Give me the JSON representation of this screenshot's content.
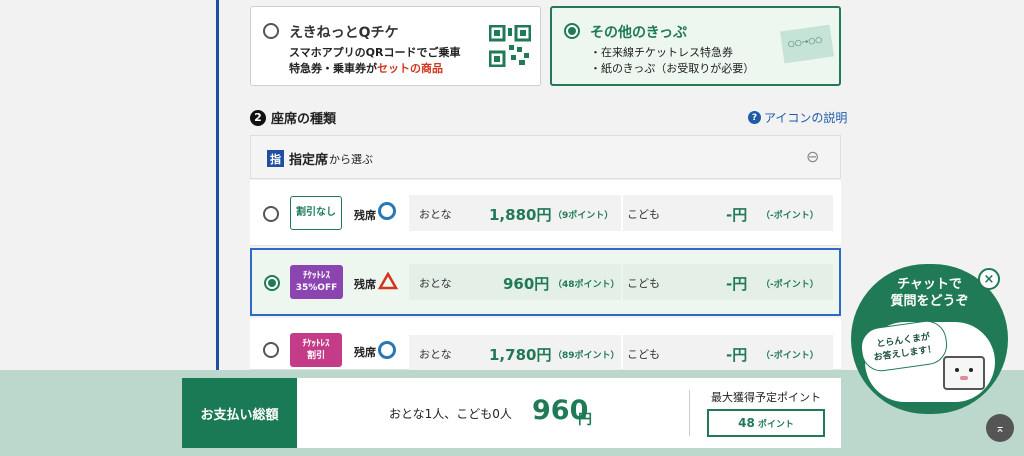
{
  "tickets": {
    "ekinet": {
      "title": "えきねっとQチケ",
      "line1": "スマホアプリのQRコードでご乗車",
      "line2_prefix": "特急券・乗車券が",
      "line2_highlight": "セットの商品"
    },
    "other": {
      "title": "その他のきっぷ",
      "bullet1": "・在来線チケットレス特急券",
      "bullet2": "・紙のきっぷ（お受取りが必要）",
      "ticket_img_text": "○○→○○"
    }
  },
  "seat_section": {
    "number": "2",
    "title": "座席の種類",
    "help_text": "アイコンの説明",
    "reserved_badge": "指",
    "reserved_title": "指定席",
    "reserved_suffix": "から選ぶ",
    "collapse_icon": "⊖"
  },
  "rows": [
    {
      "tag": "割引なし",
      "tag_line2": "",
      "remain_label": "残席",
      "remain_symbol": "○",
      "adult_label": "おとな",
      "adult_price": "1,880円",
      "adult_points": "（9ポイント）",
      "child_label": "こども",
      "child_price": "-円",
      "child_points": "（-ポイント）",
      "selected": false
    },
    {
      "tag": "ﾁｹｯﾄﾚｽ",
      "tag_line2": "35%OFF",
      "remain_label": "残席",
      "remain_symbol": "△",
      "adult_label": "おとな",
      "adult_price": "960円",
      "adult_points": "（48ポイント）",
      "child_label": "こども",
      "child_price": "-円",
      "child_points": "（-ポイント）",
      "selected": true
    },
    {
      "tag": "ﾁｹｯﾄﾚｽ",
      "tag_line2": "割引",
      "remain_label": "残席",
      "remain_symbol": "○",
      "adult_label": "おとな",
      "adult_price": "1,780円",
      "adult_points": "（89ポイント）",
      "child_label": "こども",
      "child_price": "-円",
      "child_points": "（-ポイント）",
      "selected": false
    }
  ],
  "footer": {
    "pay_label": "お支払い総額",
    "passengers": "おとな1人、こども0人",
    "total_amount": "960",
    "total_unit": "円",
    "points_title": "最大獲得予定ポイント",
    "points_value": "48",
    "points_unit": "ポイント"
  },
  "chat": {
    "line1": "チャットで",
    "line2": "質問をどうぞ",
    "bubble1": "とらんくまが",
    "bubble2": "お答えします！",
    "close_symbol": "×"
  },
  "top_button": "⌅",
  "colors": {
    "green": "#1f7a55",
    "blue": "#1f4fa0",
    "purple": "#8b44b0",
    "pink": "#c43b87",
    "red": "#d2351c"
  }
}
